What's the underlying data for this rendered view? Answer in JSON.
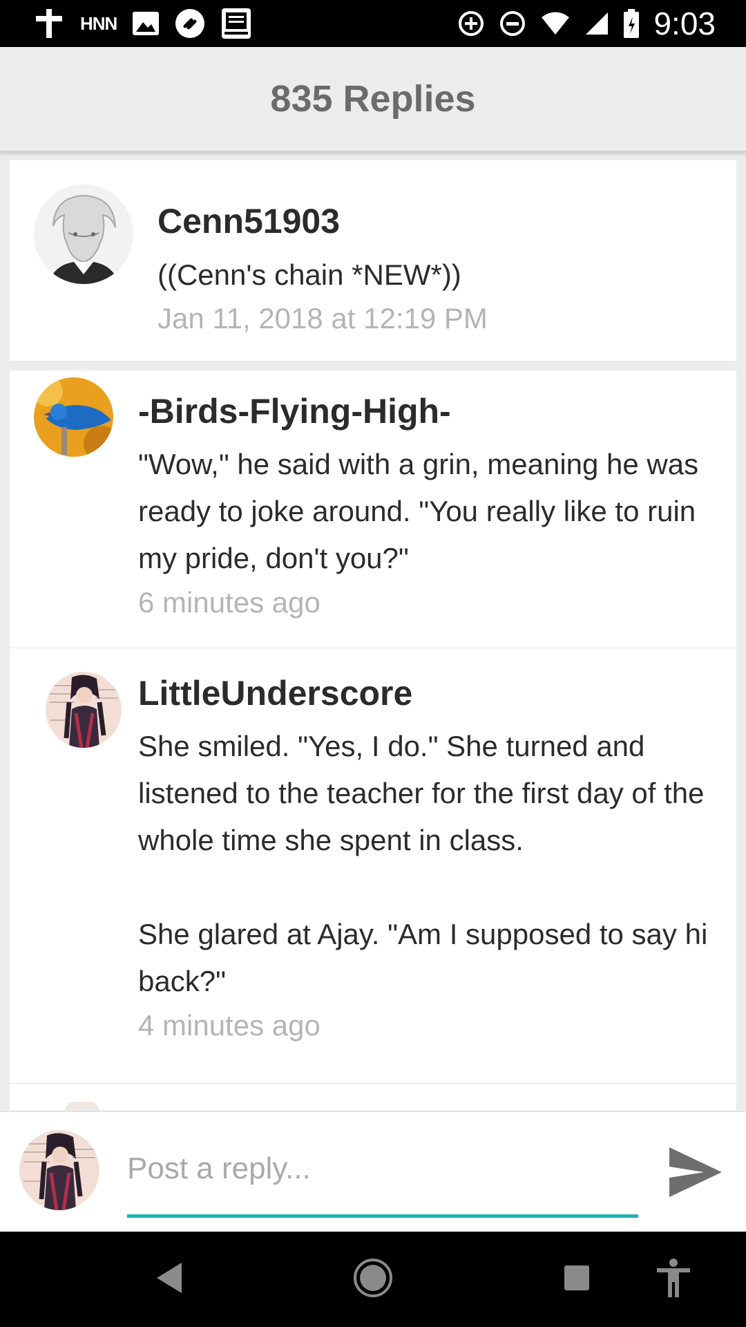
{
  "status_bar": {
    "carrier_label": "HNN",
    "time": "9:03",
    "left_icons": [
      "cross-icon",
      "hnn-icon",
      "image-icon",
      "shazam-icon",
      "bible-icon"
    ],
    "right_icons": [
      "data-saver-icon",
      "do-not-disturb-icon",
      "wifi-icon",
      "cell-signal-icon",
      "battery-icon"
    ]
  },
  "header": {
    "title": "835 Replies"
  },
  "original_post": {
    "author": "Cenn51903",
    "text": "((Cenn's chain *NEW*))",
    "timestamp": "Jan 11, 2018 at 12:19 PM"
  },
  "replies": [
    {
      "author": "-Birds-Flying-High-",
      "paragraphs": [
        "\"Wow,\" he said with a grin, meaning he was ready to joke around. \"You really like to ruin my pride, don't you?\""
      ],
      "timestamp": "6 minutes ago"
    },
    {
      "author": "LittleUnderscore",
      "paragraphs": [
        "She smiled. \"Yes, I do.\" She turned and listened to the teacher for the first day of the whole time she spent in class.",
        "She glared at Ajay. \"Am I supposed to say hi back?\""
      ],
      "timestamp": "4 minutes ago"
    }
  ],
  "reply_bar": {
    "placeholder": "Post a reply...",
    "value": "",
    "send_icon": "send-icon",
    "accent_color": "#1fb0b3"
  },
  "nav_bar": {
    "icons": [
      "back-icon",
      "home-icon",
      "recents-icon",
      "accessibility-icon"
    ]
  }
}
